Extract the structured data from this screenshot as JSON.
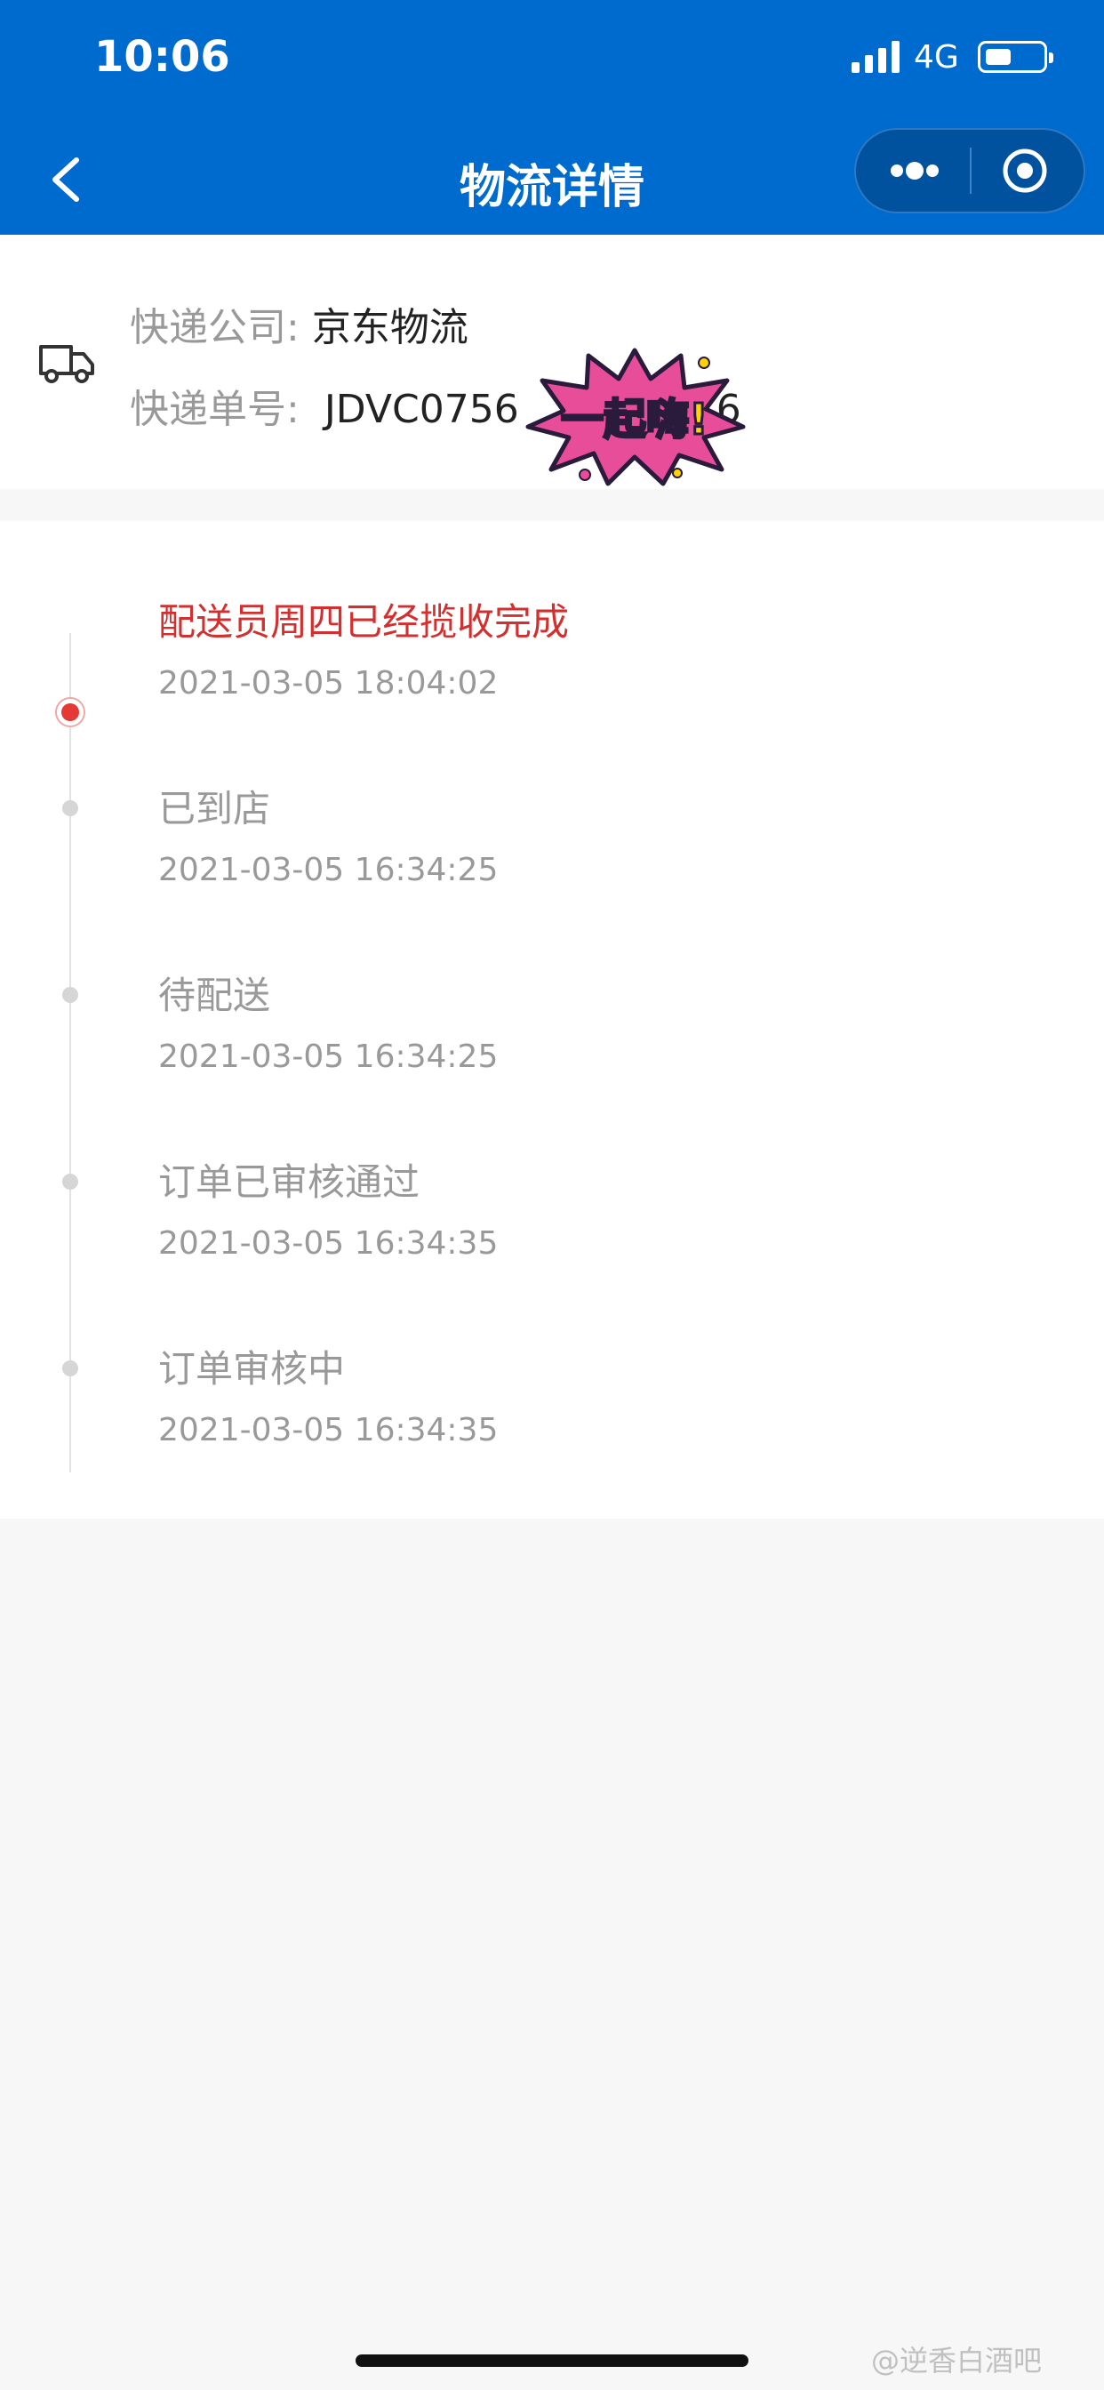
{
  "status_bar": {
    "time": "10:06",
    "network": "4G"
  },
  "nav": {
    "title": "物流详情",
    "icons": [
      "back-arrow-icon",
      "more-dots-icon",
      "target-icon"
    ]
  },
  "shipment": {
    "company_label": "快递公司:",
    "company": "京东物流",
    "number_label": "快递单号:",
    "number_visible": "JDVC0756",
    "number_tail": "6",
    "sticker_text": "一起嗨!"
  },
  "timeline": [
    {
      "title": "配送员周四已经揽收完成",
      "time": "2021-03-05 18:04:02",
      "active": true
    },
    {
      "title": "已到店",
      "time": "2021-03-05 16:34:25",
      "active": false
    },
    {
      "title": "待配送",
      "time": "2021-03-05 16:34:25",
      "active": false
    },
    {
      "title": "订单已审核通过",
      "time": "2021-03-05 16:34:35",
      "active": false
    },
    {
      "title": "订单审核中",
      "time": "2021-03-05 16:34:35",
      "active": false
    }
  ],
  "watermark": "@逆香白酒吧",
  "colors": {
    "primary": "#006bce",
    "active_red": "#d32f2f",
    "muted": "#999999"
  }
}
